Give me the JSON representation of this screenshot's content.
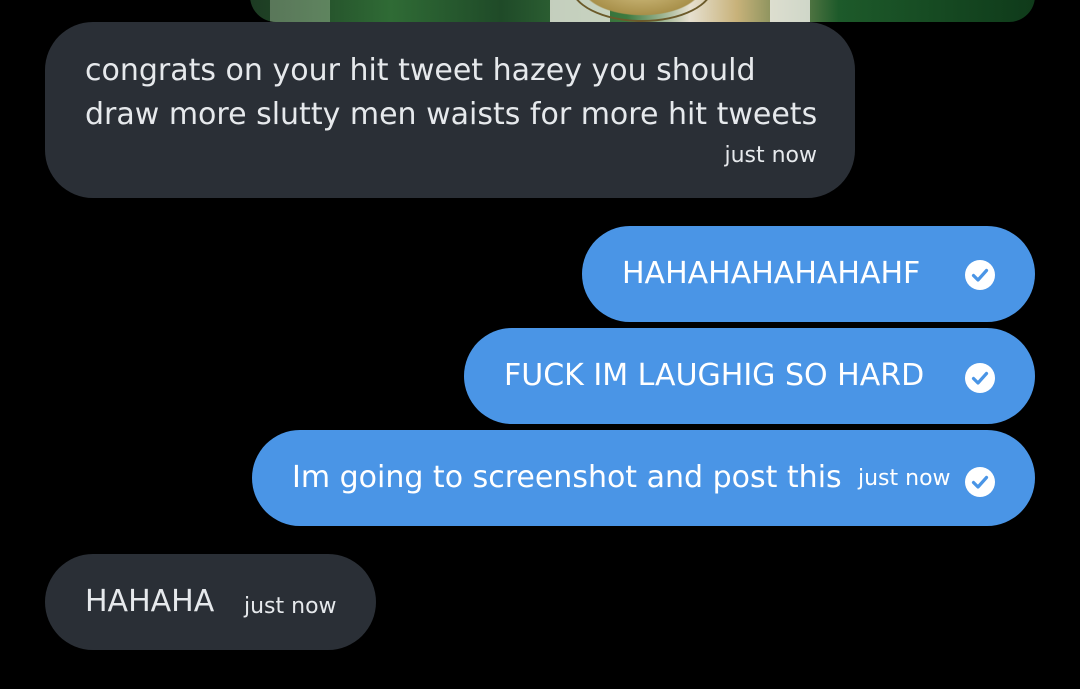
{
  "media": {
    "icon": "image-preview"
  },
  "colors": {
    "background": "#000000",
    "incoming_bubble": "#2a2f36",
    "outgoing_bubble": "#4a95e6",
    "incoming_text": "#e6e9ec",
    "outgoing_text": "#ffffff"
  },
  "messages": [
    {
      "direction": "incoming",
      "text": "congrats on your hit tweet hazey you should draw more slutty men waists for more hit tweets",
      "timestamp": "just now"
    },
    {
      "direction": "outgoing",
      "text": "HAHAHAHAHAHAHF",
      "status_icon": "check-circle-icon"
    },
    {
      "direction": "outgoing",
      "text": "FUCK IM LAUGHIG SO HARD",
      "status_icon": "check-circle-icon"
    },
    {
      "direction": "outgoing",
      "text": "Im going to screenshot and post this",
      "timestamp": "just now",
      "status_icon": "check-circle-icon"
    },
    {
      "direction": "incoming",
      "text": "HAHAHA",
      "timestamp": "just now"
    }
  ]
}
